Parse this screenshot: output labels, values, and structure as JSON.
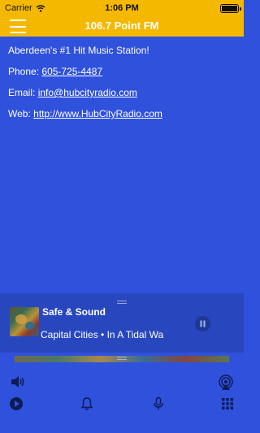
{
  "status_bar": {
    "carrier": "Carrier",
    "time": "1:06 PM"
  },
  "nav": {
    "title": "106.7 Point FM",
    "menu_icon": "hamburger-menu-icon"
  },
  "content": {
    "tagline": "Aberdeen's #1 Hit Music Station!",
    "phone_label": "Phone:",
    "phone_value": "605-725-4487",
    "email_label": "Email:",
    "email_value": "info@hubcityradio.com",
    "web_label": "Web:",
    "web_value": "http://www.HubCityRadio.com"
  },
  "player": {
    "song_title": "Safe & Sound",
    "song_info": "Capital Cities • In A Tidal Wa",
    "state": "playing"
  },
  "bottom_bar": {
    "left_icon": "speaker-icon",
    "right_icon": "airplay-icon",
    "tabs": [
      "play-circle-icon",
      "bell-icon",
      "microphone-icon",
      "grid-icon"
    ]
  },
  "colors": {
    "accent": "#f5b800",
    "background": "#2f51dc",
    "player_background": "#2847bf",
    "text": "#ffffff"
  }
}
